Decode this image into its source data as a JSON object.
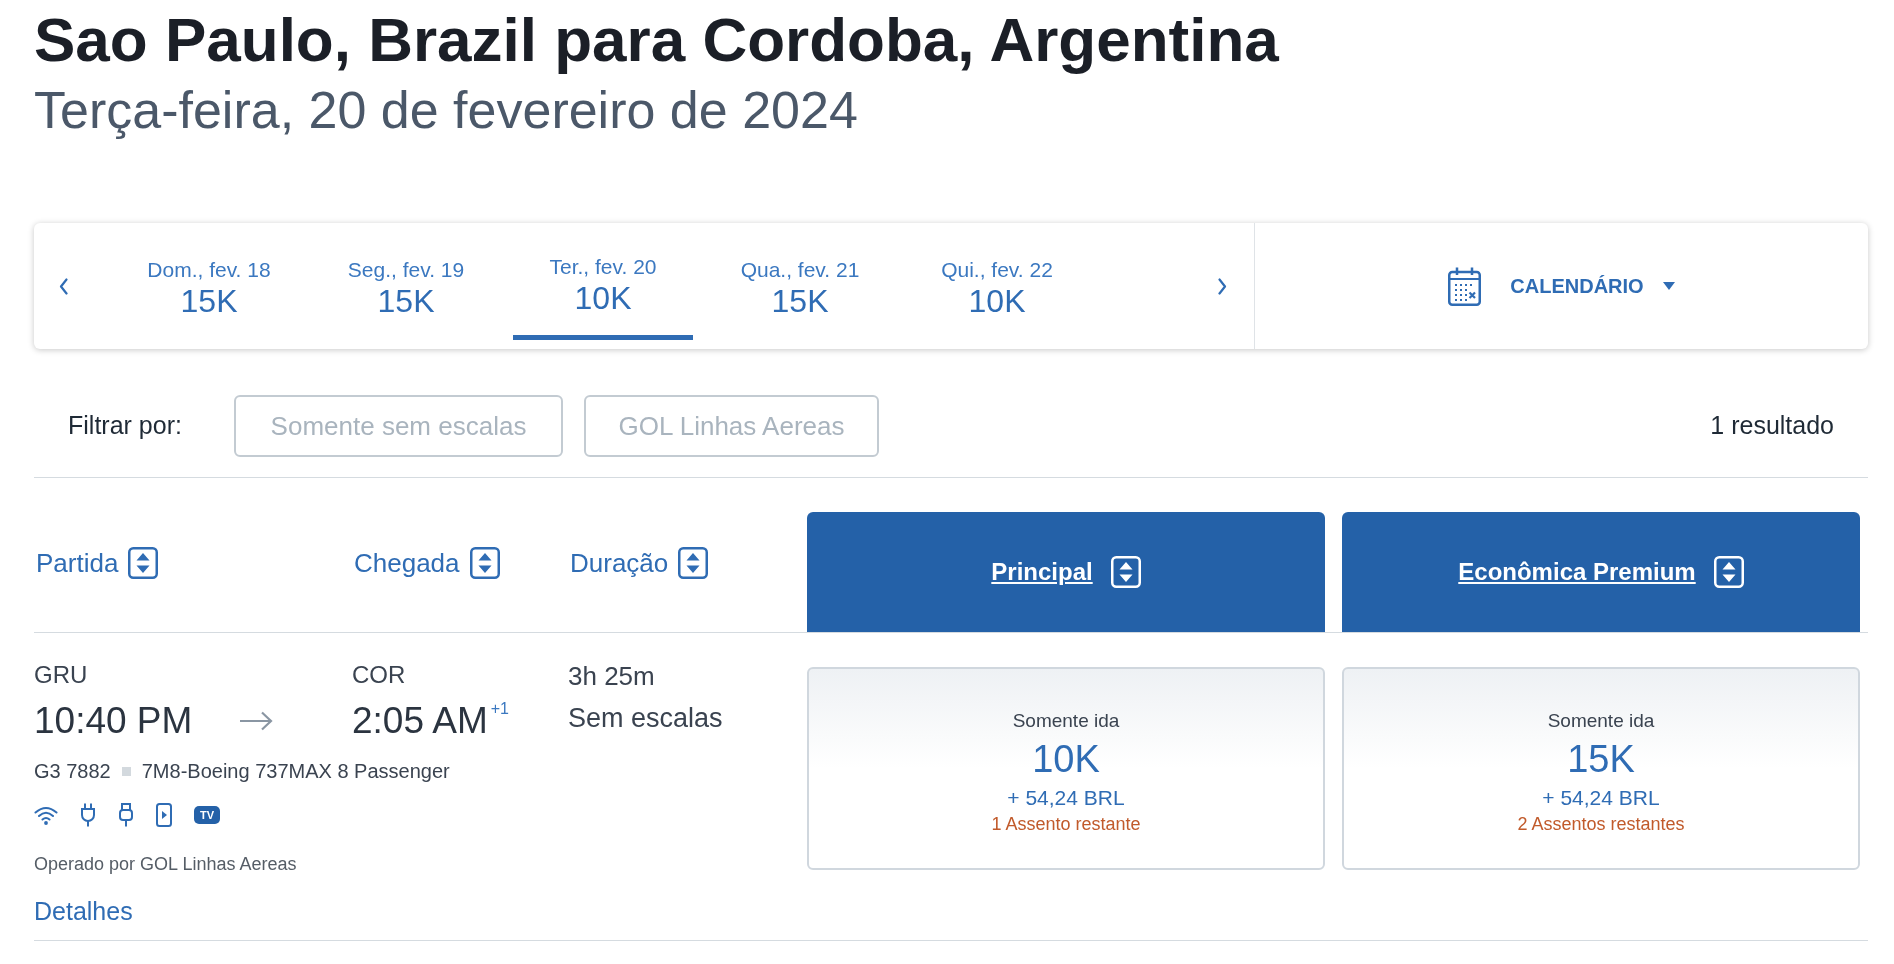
{
  "title": "Sao Paulo, Brazil para Cordoba, Argentina",
  "subtitle": "Terça-feira, 20 de fevereiro de 2024",
  "date_selector": {
    "dates": [
      {
        "label": "Dom., fev. 18",
        "price": "15K",
        "selected": false
      },
      {
        "label": "Seg., fev. 19",
        "price": "15K",
        "selected": false
      },
      {
        "label": "Ter., fev. 20",
        "price": "10K",
        "selected": true
      },
      {
        "label": "Qua., fev. 21",
        "price": "15K",
        "selected": false
      },
      {
        "label": "Qui., fev. 22",
        "price": "10K",
        "selected": false
      }
    ],
    "calendar_button": "CALENDÁRIO"
  },
  "filters": {
    "label": "Filtrar por:",
    "options": [
      {
        "label": "Somente sem escalas",
        "selected": false
      },
      {
        "label": "GOL Linhas Aereas",
        "selected": false
      }
    ],
    "result_count": "1 resultado"
  },
  "columns": [
    "Partida",
    "Chegada",
    "Duração"
  ],
  "fare_columns": [
    "Principal",
    "Econômica Premium"
  ],
  "flights": [
    {
      "origin": "GRU",
      "departure_time": "10:40 PM",
      "destination": "COR",
      "arrival_time": "2:05 AM",
      "arrival_day_offset": "+1",
      "duration": "3h 25m",
      "stops": "Sem escalas",
      "flight_number": "G3 7882",
      "aircraft": "7M8-Boeing 737MAX 8 Passenger",
      "amenities": [
        {
          "kind": "wifi"
        },
        {
          "kind": "power"
        },
        {
          "kind": "usb"
        },
        {
          "kind": "streaming"
        },
        {
          "kind": "tv",
          "label": "TV"
        }
      ],
      "operator": "Operado por GOL Linhas Aereas",
      "details_link": "Detalhes",
      "fares": [
        {
          "trip_type": "Somente ida",
          "miles": "10K",
          "taxes": "+ 54,24 BRL",
          "seats_left": "1 Assento restante"
        },
        {
          "trip_type": "Somente ida",
          "miles": "15K",
          "taxes": "+ 54,24 BRL",
          "seats_left": "2 Assentos restantes"
        }
      ]
    }
  ]
}
